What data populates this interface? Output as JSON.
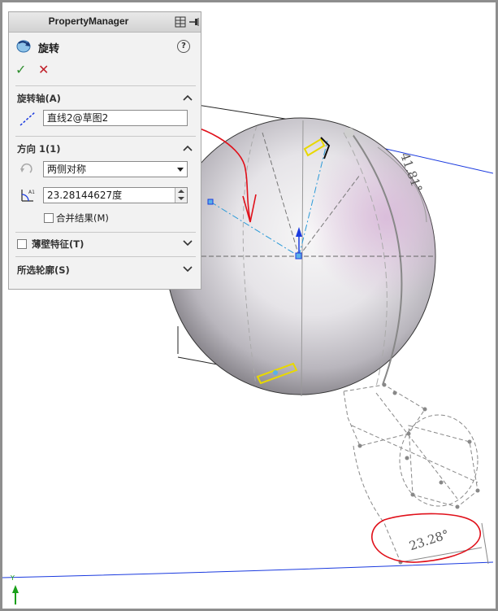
{
  "panel": {
    "title": "PropertyManager",
    "feature_name": "旋转",
    "help": "?",
    "ok": "✓",
    "cancel": "✕"
  },
  "axis_section": {
    "title": "旋转轴(A)",
    "value": "直线2@草图2"
  },
  "direction_section": {
    "title": "方向 1(1)",
    "type_value": "两侧对称",
    "angle_value": "23.28144627度",
    "merge_label": "合并结果(M)",
    "merge_checked": false
  },
  "thin_section": {
    "title": "薄壁特征(T)",
    "checked": false
  },
  "contours_section": {
    "title": "所选轮廓(S)"
  },
  "dimensions": {
    "upper": "41.81°",
    "lower": "23.28°"
  },
  "triad": {
    "y_label": "Y"
  },
  "colors": {
    "annotation_red": "#e0101a",
    "sketch_blue": "#1a3adf",
    "check_green": "#2f8f2f"
  }
}
